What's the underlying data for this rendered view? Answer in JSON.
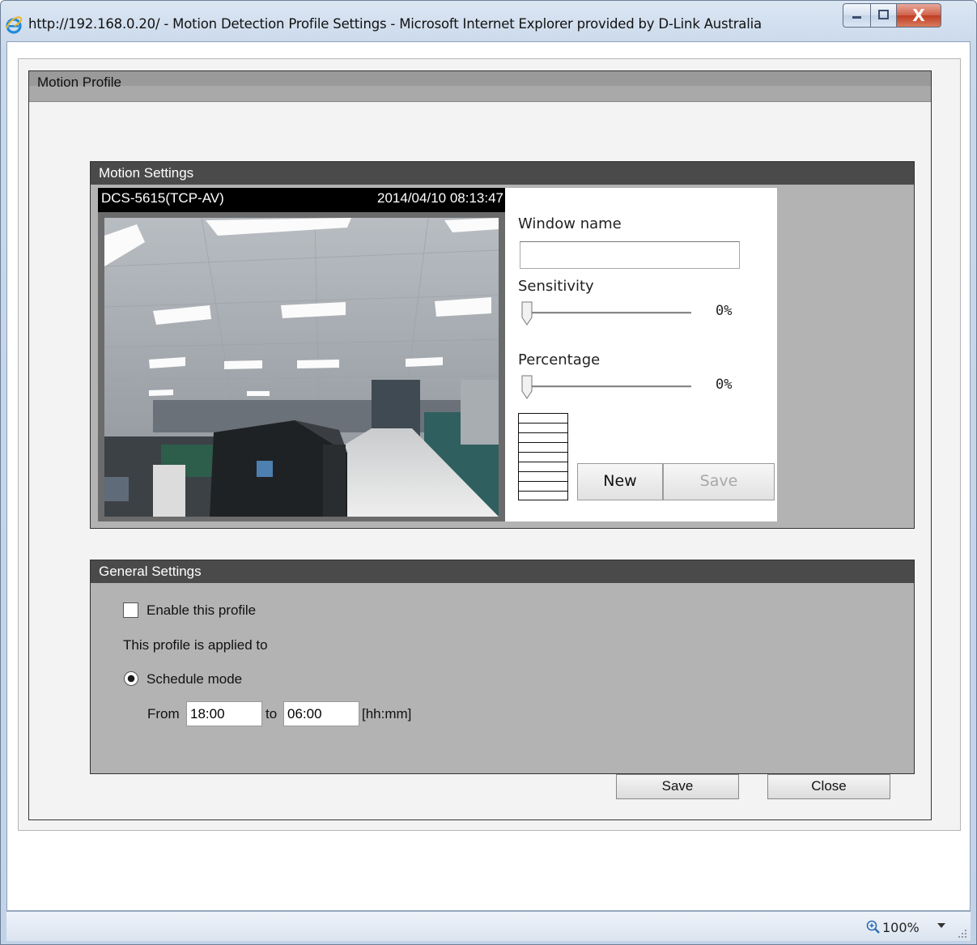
{
  "window": {
    "title": "http://192.168.0.20/ - Motion Detection Profile Settings - Microsoft Internet Explorer provided by D-Link Australia",
    "controls": [
      "minimize-icon",
      "maximize-icon",
      "close-icon"
    ],
    "close_glyph": "X"
  },
  "profile": {
    "title": "Motion Profile"
  },
  "motion_settings": {
    "title": "Motion Settings",
    "camera_name": "DCS-5615(TCP-AV)",
    "timestamp": "2014/04/10 08:13:47",
    "window_name_label": "Window name",
    "window_name_value": "",
    "sensitivity_label": "Sensitivity",
    "sensitivity_value": "0%",
    "sensitivity_level": 0,
    "percentage_label": "Percentage",
    "percentage_value": "0%",
    "percentage_level": 0,
    "new_button": "New",
    "save_button": "Save",
    "save_button_enabled": false
  },
  "general_settings": {
    "title": "General Settings",
    "enable_label": "Enable this profile",
    "enable_checked": false,
    "applied_to_label": "This profile is applied to",
    "schedule_mode_label": "Schedule mode",
    "schedule_mode_selected": true,
    "from_label": "From",
    "from_value": "18:00",
    "to_label": "to",
    "to_value": "06:00",
    "format_hint": "[hh:mm]"
  },
  "footer": {
    "save_button": "Save",
    "close_button": "Close"
  },
  "statusbar": {
    "zoom": "100%"
  },
  "colors": {
    "section_header": "#4a4a4a",
    "section_body": "#b3b3b3",
    "profile_header": "#9a9a9a"
  }
}
